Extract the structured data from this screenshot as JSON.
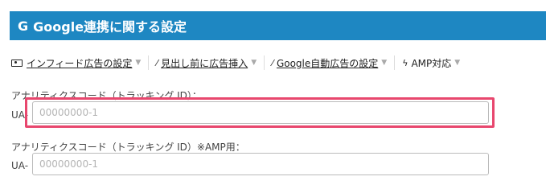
{
  "header": {
    "icon": "G",
    "title": "Google連携に関する設定"
  },
  "tabs": [
    {
      "icon": "money-icon",
      "label": "インフィード広告の設定"
    },
    {
      "icon": "magic-wand-icon",
      "label": "見出し前に広告挿入"
    },
    {
      "icon": "magic-wand-icon",
      "label": "Google自動広告の設定"
    },
    {
      "icon": "lightning-icon",
      "label": "AMP対応"
    }
  ],
  "fields": {
    "analytics": {
      "label": "アナリティクスコード（トラッキング ID）：",
      "prefix": "UA-",
      "placeholder": "00000000-1",
      "value": ""
    },
    "analytics_amp": {
      "label": "アナリティクスコード（トラッキング ID）※AMP用：",
      "prefix": "UA-",
      "placeholder": "00000000-1",
      "value": ""
    }
  },
  "colors": {
    "header_bg": "#1e87c2",
    "highlight": "#e8476e"
  }
}
